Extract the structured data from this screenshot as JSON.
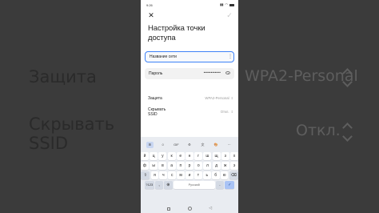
{
  "background": {
    "security_label": "Защита",
    "security_value": "WPA2-Personal",
    "hide_ssid_label_line1": "Скрывать",
    "hide_ssid_label_line2": "SSID",
    "hide_ssid_value": "Откл."
  },
  "status_bar": {
    "time": "9:26"
  },
  "header": {
    "title": "Настройка точки доступа",
    "close_icon": "close-icon",
    "confirm_icon": "check-icon"
  },
  "form": {
    "network_name_placeholder": "Название сети",
    "password_label": "Пароль",
    "password_mask": "••••••••••••",
    "security_label": "Защита",
    "security_value": "WPA2-Personal",
    "hide_ssid_label_line1": "Скрывать",
    "hide_ssid_label_line2": "SSID",
    "hide_ssid_value": "Откл."
  },
  "keyboard": {
    "toolbar": [
      "⊞",
      "☺",
      "GIF",
      "⚙",
      "文",
      "🎨",
      "⋯"
    ],
    "row1": [
      "й",
      "ц",
      "у",
      "к",
      "е",
      "н",
      "г",
      "ш",
      "щ",
      "з",
      "х"
    ],
    "row2": [
      "ф",
      "ы",
      "в",
      "а",
      "п",
      "р",
      "о",
      "л",
      "д",
      "ж",
      "э"
    ],
    "row3_keys": [
      "я",
      "ч",
      "с",
      "м",
      "и",
      "т",
      "ь",
      "б",
      "ю"
    ],
    "shift": "⇧",
    "backspace": "⌫",
    "symbols": "?123",
    "comma": ",",
    "globe": "⊕",
    "space": "Русский",
    "period": ".",
    "enter": "✓"
  },
  "colors": {
    "accent": "#3d82f7",
    "background_blur": "#3b3b3b"
  }
}
